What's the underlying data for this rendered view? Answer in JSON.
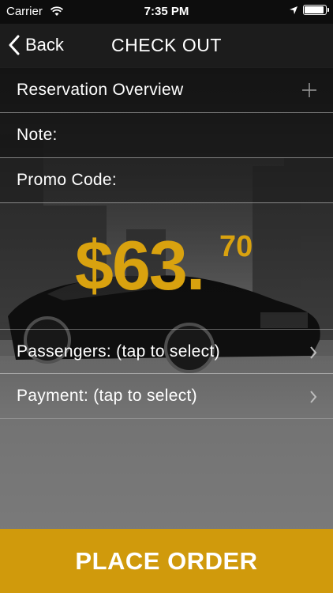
{
  "status_bar": {
    "carrier": "Carrier",
    "time": "7:35 PM"
  },
  "nav": {
    "back_label": "Back",
    "title": "CHECK OUT"
  },
  "rows": {
    "reservation_overview": "Reservation Overview",
    "note": "Note:",
    "promo_code": "Promo Code:",
    "passengers": "Passengers: (tap to select)",
    "payment": "Payment:  (tap to select)"
  },
  "price": {
    "dollars": "$63.",
    "cents": "70"
  },
  "cta": {
    "label": "PLACE ORDER"
  },
  "colors": {
    "accent": "#d09a0c",
    "price": "#d9a20f",
    "bar": "#1c1c1c"
  },
  "icons": [
    "wifi-icon",
    "location-arrow-icon",
    "battery-icon",
    "chevron-left-icon",
    "plus-icon",
    "chevron-right-icon"
  ]
}
